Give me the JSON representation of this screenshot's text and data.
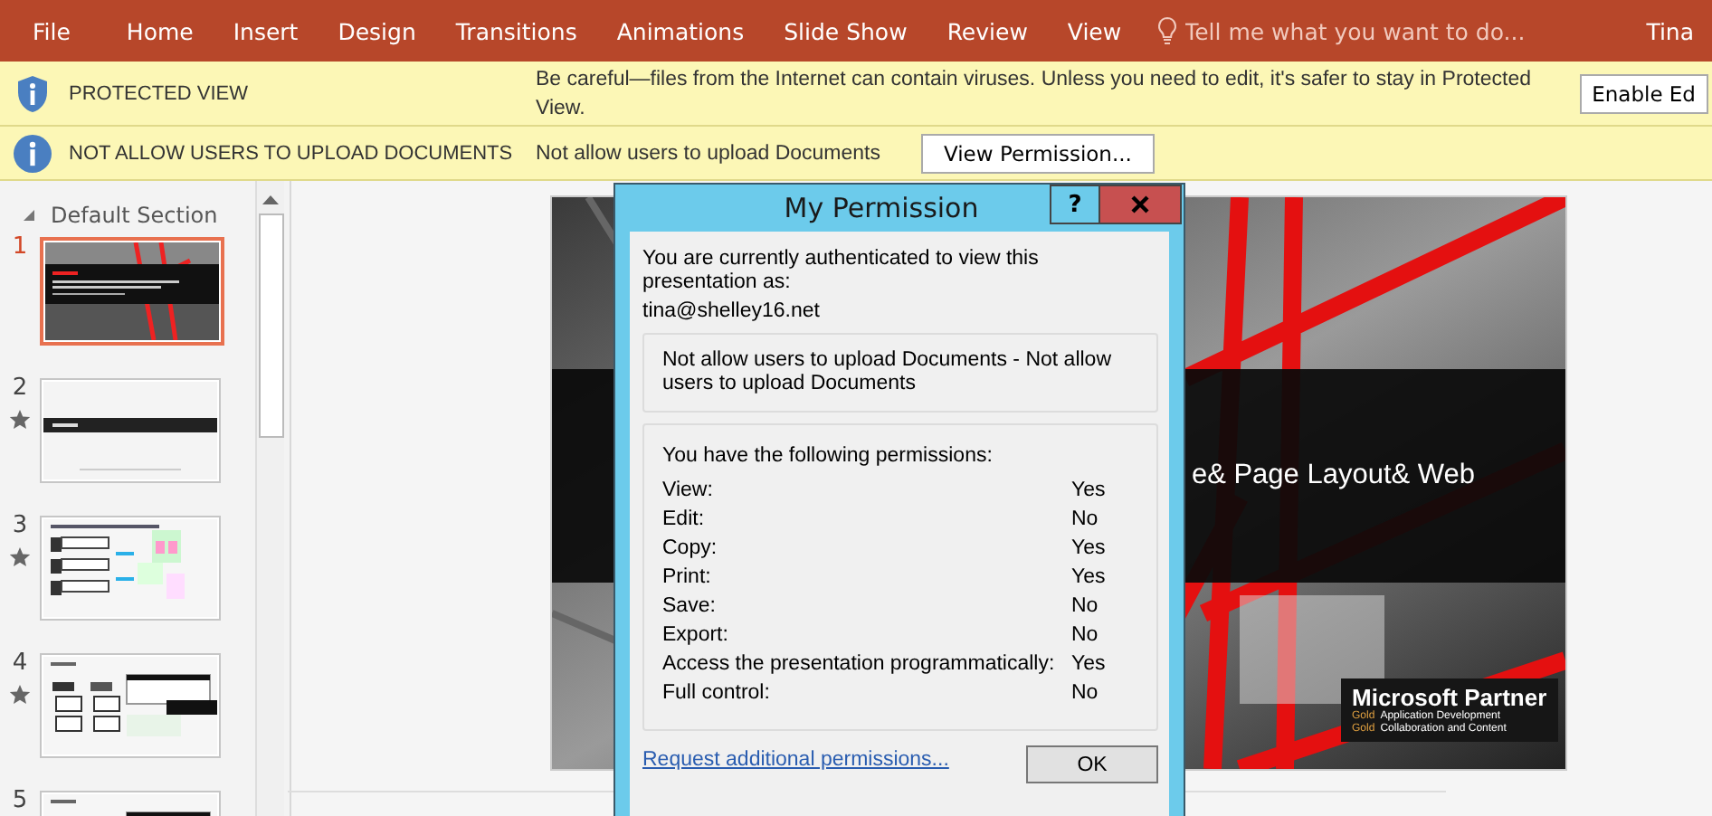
{
  "ribbon": {
    "file_tab": "File",
    "tabs": [
      {
        "label": "Home",
        "selected": false
      },
      {
        "label": "Insert",
        "selected": false
      },
      {
        "label": "Design",
        "selected": false
      },
      {
        "label": "Transitions",
        "selected": false
      },
      {
        "label": "Animations",
        "selected": false
      },
      {
        "label": "Slide Show",
        "selected": false
      },
      {
        "label": "Review",
        "selected": false
      },
      {
        "label": "View",
        "selected": false
      }
    ],
    "tell_me": {
      "placeholder": "Tell me what you want to do..."
    },
    "user": "Tina"
  },
  "message_bars": [
    {
      "kind": "shield",
      "title": "PROTECTED VIEW",
      "message": "Be careful—files from the Internet can contain viruses. Unless you need to edit, it's safer to stay in Protected View.",
      "button": "Enable Ed"
    },
    {
      "kind": "info",
      "title": "NOT ALLOW USERS TO UPLOAD DOCUMENTS",
      "message": "Not allow users to upload Documents",
      "button": "View Permission..."
    }
  ],
  "slides_pane": {
    "section": {
      "label": "Default Section",
      "expanded": true
    },
    "slides": [
      {
        "number": "1",
        "selected": true,
        "starred": false,
        "kind": "title"
      },
      {
        "number": "2",
        "selected": false,
        "starred": true,
        "kind": "banner"
      },
      {
        "number": "3",
        "selected": false,
        "starred": true,
        "kind": "diagram"
      },
      {
        "number": "4",
        "selected": false,
        "starred": true,
        "kind": "layout"
      },
      {
        "number": "5",
        "selected": false,
        "starred": false,
        "kind": "layout"
      }
    ]
  },
  "slide": {
    "title": "e& Page Layout& Web",
    "partner": "Microsoft Partner",
    "lines": [
      {
        "tier": "Gold",
        "text": "Application Development"
      },
      {
        "tier": "Gold",
        "text": "Collaboration and Content"
      }
    ]
  },
  "dialog": {
    "title": "My Permission",
    "help_button": "?",
    "intro": "You are currently authenticated to view this presentation as:",
    "account": "tina@shelley16.net",
    "description": "Not allow users to upload Documents - Not allow users to upload Documents",
    "permissions_heading": "You have the following permissions:",
    "permissions": [
      {
        "name": "View:",
        "value": "Yes"
      },
      {
        "name": "Edit:",
        "value": "No"
      },
      {
        "name": "Copy:",
        "value": "Yes"
      },
      {
        "name": "Print:",
        "value": "Yes"
      },
      {
        "name": "Save:",
        "value": "No"
      },
      {
        "name": "Export:",
        "value": "No"
      },
      {
        "name": "Access the presentation programmatically:",
        "value": "Yes"
      },
      {
        "name": "Full control:",
        "value": "No"
      }
    ],
    "link": "Request additional permissions...",
    "ok_button": "OK"
  }
}
